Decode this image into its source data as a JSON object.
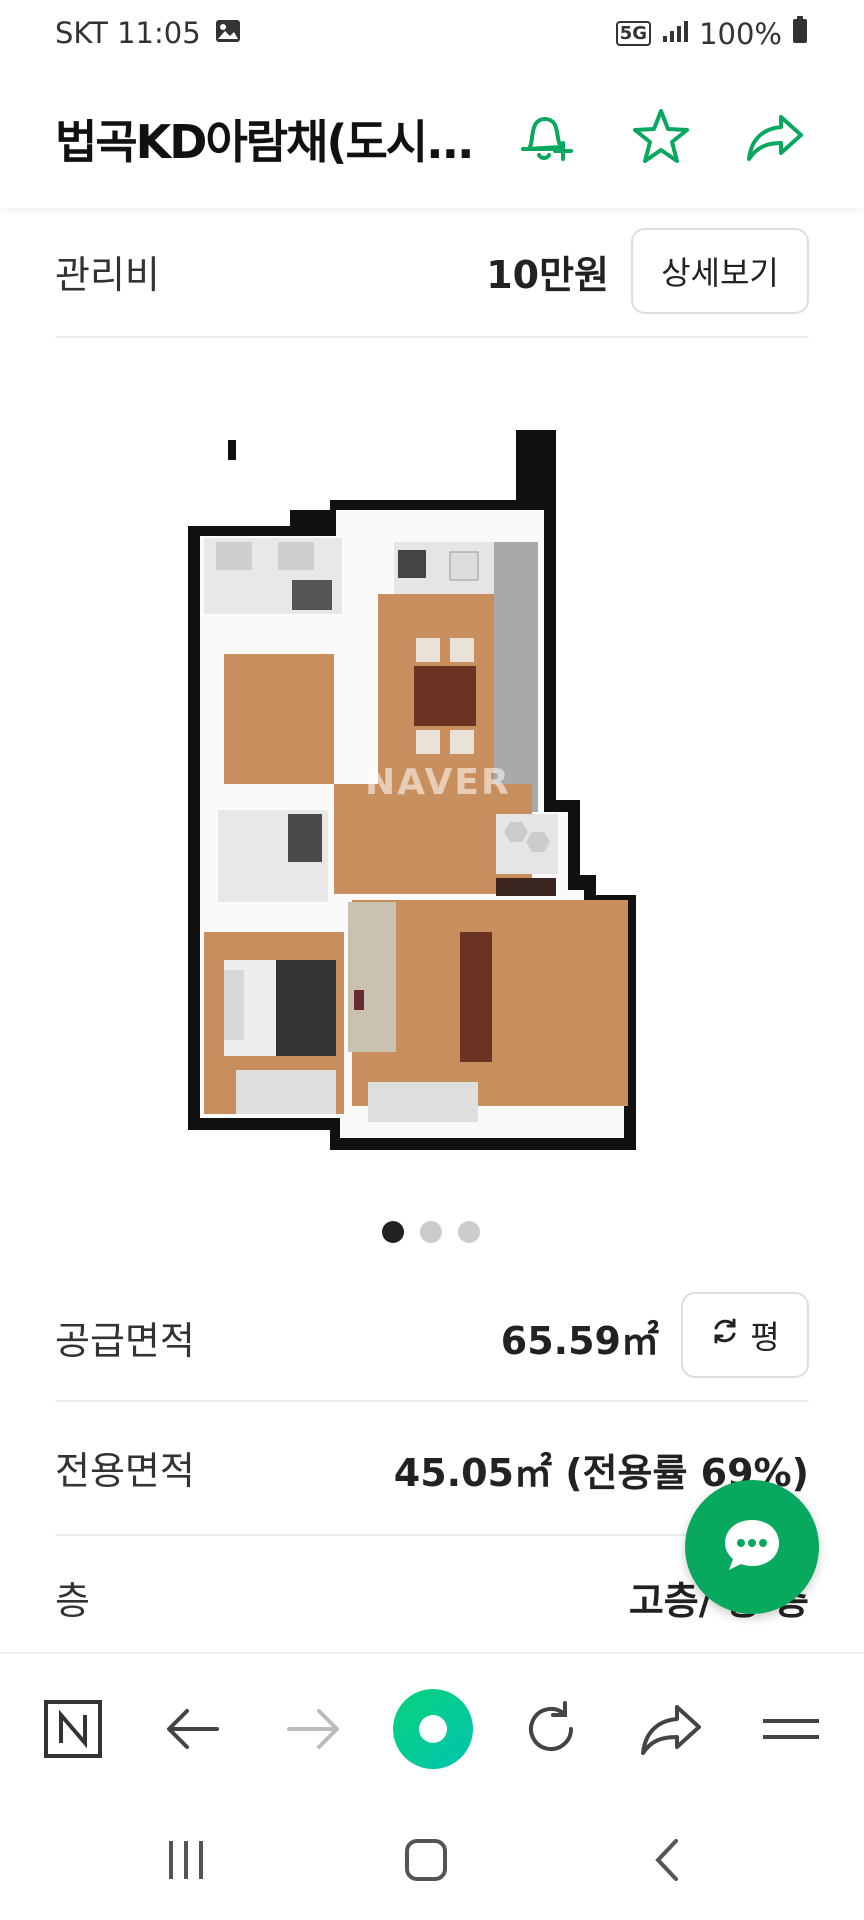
{
  "status_bar": {
    "carrier_time": "SKT 11:05",
    "network": "5G",
    "battery": "100%"
  },
  "header": {
    "title": "법곡KD아람채(도시...",
    "icons": [
      "bell-plus-icon",
      "star-icon",
      "share-icon"
    ]
  },
  "maintenance": {
    "label": "관리비",
    "value": "10만원",
    "detail_button": "상세보기"
  },
  "floorplan": {
    "watermark": "NAVER",
    "pager": {
      "count": 3,
      "active_index": 0
    }
  },
  "supply_area": {
    "label": "공급면적",
    "value": "65.59㎡",
    "unit_toggle": "평"
  },
  "exclusive_area": {
    "label": "전용면적",
    "value": "45.05㎡ (전용률 69%)"
  },
  "floor": {
    "label": "층",
    "value": "고층/ 총 층"
  },
  "colors": {
    "accent": "#09a85f",
    "brand_green": "#03c75a",
    "text": "#222222"
  },
  "toolbar": {
    "icons": [
      "naver-n-icon",
      "back-arrow-icon",
      "forward-arrow-icon",
      "naver-green-dot-icon",
      "refresh-icon",
      "share-icon",
      "menu-icon"
    ]
  },
  "navbar": {
    "icons": [
      "recent-apps-icon",
      "home-icon",
      "back-icon"
    ]
  }
}
